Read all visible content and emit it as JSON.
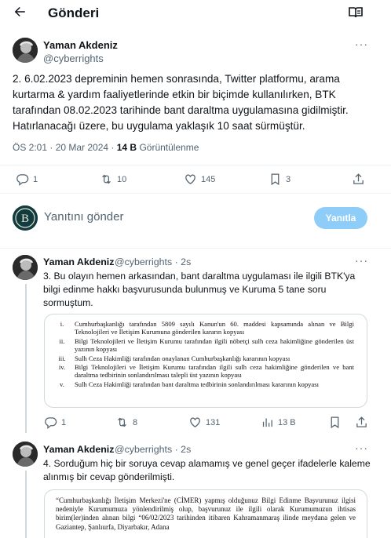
{
  "header": {
    "title": "Gönderi",
    "back_icon": "arrow-left-icon",
    "reader_icon": "reader-mode-icon"
  },
  "main_tweet": {
    "author_name": "Yaman Akdeniz",
    "handle": "@cyberrights",
    "more": "···",
    "text": "2. 6.02.2023 depreminin hemen sonrasında, Twitter platformu, arama kurtarma & yardım faaliyetlerinde etkin bir biçimde kullanılırken, BTK tarafından 08.02.2023 tarihinde bant daraltma uygulamasına gidilmiştir. Hatırlanacağı üzere, bu uygulama yaklaşık 10 saat sürmüştür.",
    "time": "ÖS 2:01 · 20 Mar 2024 · ",
    "views_count": "14 B",
    "views_label": "Görüntülenme",
    "actions": {
      "replies": "1",
      "reposts": "10",
      "likes": "145",
      "bookmarks": "3"
    }
  },
  "composer": {
    "avatar_text": "B",
    "placeholder": "Yanıtını gönder",
    "button": "Yanıtla"
  },
  "replies": [
    {
      "author_name": "Yaman Akdeniz",
      "handle": "@cyberrights · 2s",
      "more": "···",
      "text": "3. Bu olayın hemen arkasından, bant daraltma uygulaması ile ilgili BTK'ya bilgi edinme hakkı başvurusunda bulunmuş ve Kuruma 5 tane soru sormuştum.",
      "doc_items": [
        {
          "num": "i.",
          "text": "Cumhurbaşkanlığı tarafından 5809 sayılı Kanun'un 60. maddesi kapsamında alınan ve Bilgi Teknolojileri ve İletişim Kurumuna gönderilen kararın kopyası"
        },
        {
          "num": "ii.",
          "text": "Bilgi Teknolojileri ve İletişim Kurumu tarafından ilgili nöbetçi sulh ceza hakimliğine gönderilen üst yazının kopyası"
        },
        {
          "num": "iii.",
          "text": "Sulh Ceza Hakimliği tarafından onaylanan Cumhurbaşkanlığı kararının kopyası"
        },
        {
          "num": "iv.",
          "text": "Bilgi Teknolojileri ve İletişim Kurumu tarafından ilgili sulh ceza hakimliğine gönderilen ve bant daraltma tedbirinin sonlandırılması talepli üst yazının kopyası"
        },
        {
          "num": "v.",
          "text": "Sulh Ceza Hakimliği tarafından bant daraltma tedbirinin sonlandırılması kararının kopyası"
        }
      ],
      "actions": {
        "replies": "1",
        "reposts": "8",
        "likes": "131",
        "views": "13 B"
      }
    },
    {
      "author_name": "Yaman Akdeniz",
      "handle": "@cyberrights · 2s",
      "more": "···",
      "text": "4. Sorduğum hiç bir soruya cevap alamamış ve genel geçer ifadelerle kaleme alınmış bir cevap gönderilmişti.",
      "doc_text": "“Cumhurbaşkanlığı İletişim Merkezi'ne (CİMER) yapmış olduğunuz Bilgi Edinme Başvurunuz ilgisi nedeniyle Kurumumuza yönlendirilmiş olup, başvurunuz ile ilgili olarak Kurumumuzun ihtisas birim(ler)inden alınan bilgi “06/02/2023 tarihinden itibaren Kahramanmaraş ilinde meydana gelen ve Gaziantep, Şanlıurfa, Diyarbakır, Adana"
    }
  ]
}
